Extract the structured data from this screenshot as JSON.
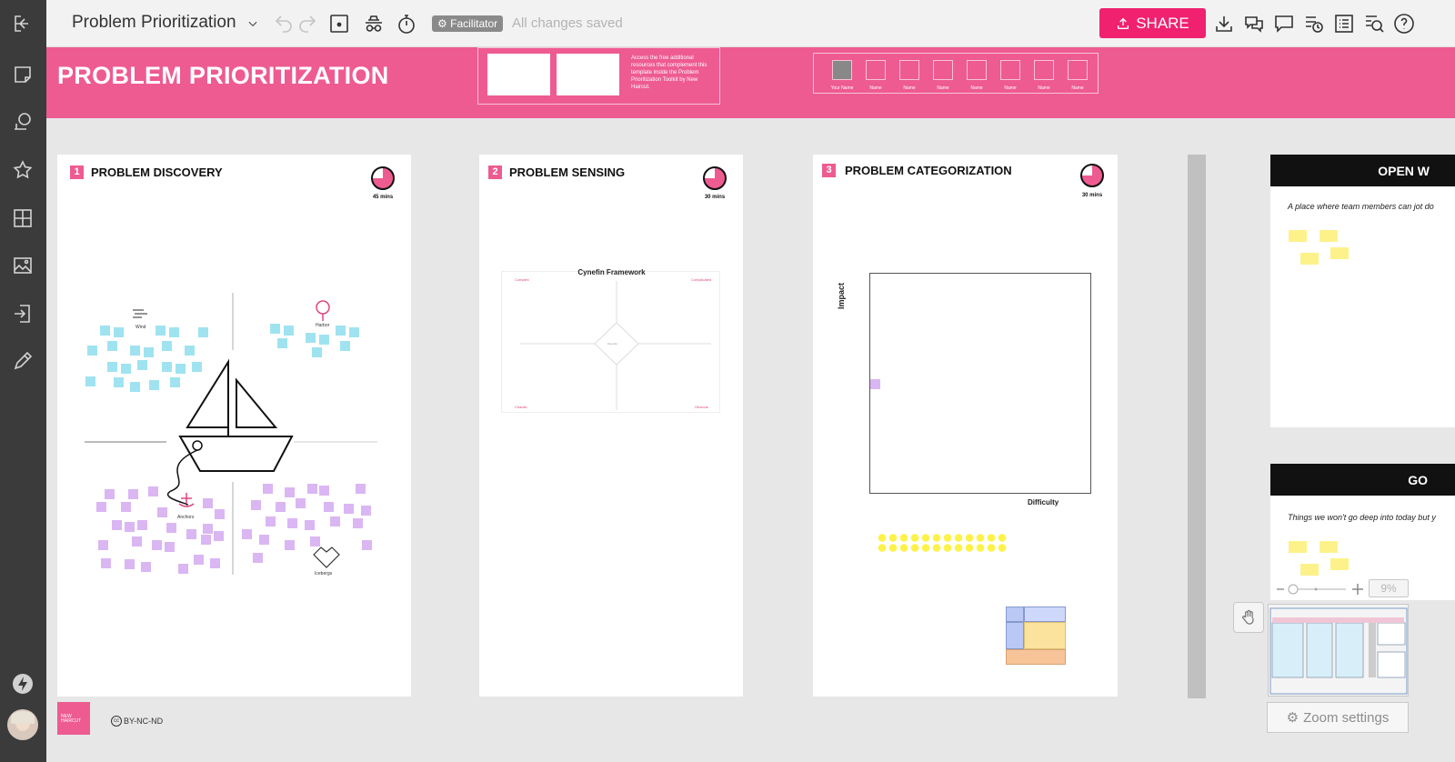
{
  "topbar": {
    "board_title": "Problem Prioritization",
    "facilitator_label": "Facilitator",
    "save_status": "All changes saved",
    "share_label": "SHARE"
  },
  "header": {
    "title": "PROBLEM PRIORITIZATION",
    "resources_text": "Access the free additional resources that complement this template inside the Problem Prioritization Toolkit by New Haircut.",
    "attendees": [
      "Your Name",
      "Name",
      "Name",
      "Name",
      "Name",
      "Name",
      "Name",
      "Name"
    ]
  },
  "panels": [
    {
      "num": "1",
      "title": "PROBLEM DISCOVERY",
      "time": "45 mins",
      "labels": {
        "wind": "Wind",
        "harbor": "Harbor",
        "anchors": "Anchors",
        "icebergs": "Icebergs"
      }
    },
    {
      "num": "2",
      "title": "PROBLEM SENSING",
      "time": "30 mins",
      "framework_title": "Cynefin Framework",
      "quadrants": [
        "Complex",
        "Complicated",
        "Chaotic",
        "Obvious"
      ],
      "center": "Disorder"
    },
    {
      "num": "3",
      "title": "PROBLEM CATEGORIZATION",
      "time": "30 mins",
      "y_axis": "Impact",
      "x_axis": "Difficulty"
    }
  ],
  "right_panels": {
    "open_title": "OPEN W",
    "open_desc": "A place where team members can jot do",
    "goals_title": "GO",
    "goals_desc": "Things we won't go deep into today but y"
  },
  "footer": {
    "logo_text": "NEW HAIRCUT",
    "license": "BY-NC-ND"
  },
  "zoom": {
    "level": "9%",
    "settings_label": "Zoom settings"
  },
  "colors": {
    "brand_pink": "#ee5b91",
    "share_pink": "#f0216f",
    "note_cyan": "#9fe3f0",
    "note_lilac": "#dab6f2",
    "note_yellow": "#fdf28a"
  }
}
